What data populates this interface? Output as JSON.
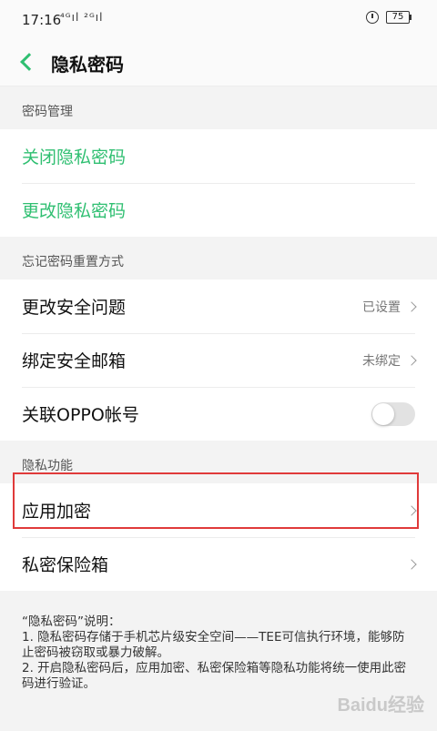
{
  "status": {
    "time": "17:16",
    "signal": "⁴ᴳıl ²ᴳıl",
    "battery": "75"
  },
  "header": {
    "title": "隐私密码"
  },
  "sections": {
    "password_manage": {
      "label": "密码管理",
      "items": [
        "关闭隐私密码",
        "更改隐私密码"
      ]
    },
    "reset": {
      "label": "忘记密码重置方式",
      "items": [
        {
          "label": "更改安全问题",
          "value": "已设置"
        },
        {
          "label": "绑定安全邮箱",
          "value": "未绑定"
        },
        {
          "label": "关联OPPO帐号",
          "toggle": false
        }
      ]
    },
    "privacy": {
      "label": "隐私功能",
      "items": [
        "应用加密",
        "私密保险箱"
      ]
    }
  },
  "notes": [
    "“隐私密码”说明：",
    "1. 隐私密码存储于手机芯片级安全空间——TEE可信执行环境，能够防止密码被窃取或暴力破解。",
    "2. 开启隐私密码后，应用加密、私密保险箱等隐私功能将统一使用此密码进行验证。"
  ],
  "watermark": "Baidu经验",
  "colors": {
    "accent": "#2fbf71",
    "highlight": "#e03a3a"
  }
}
